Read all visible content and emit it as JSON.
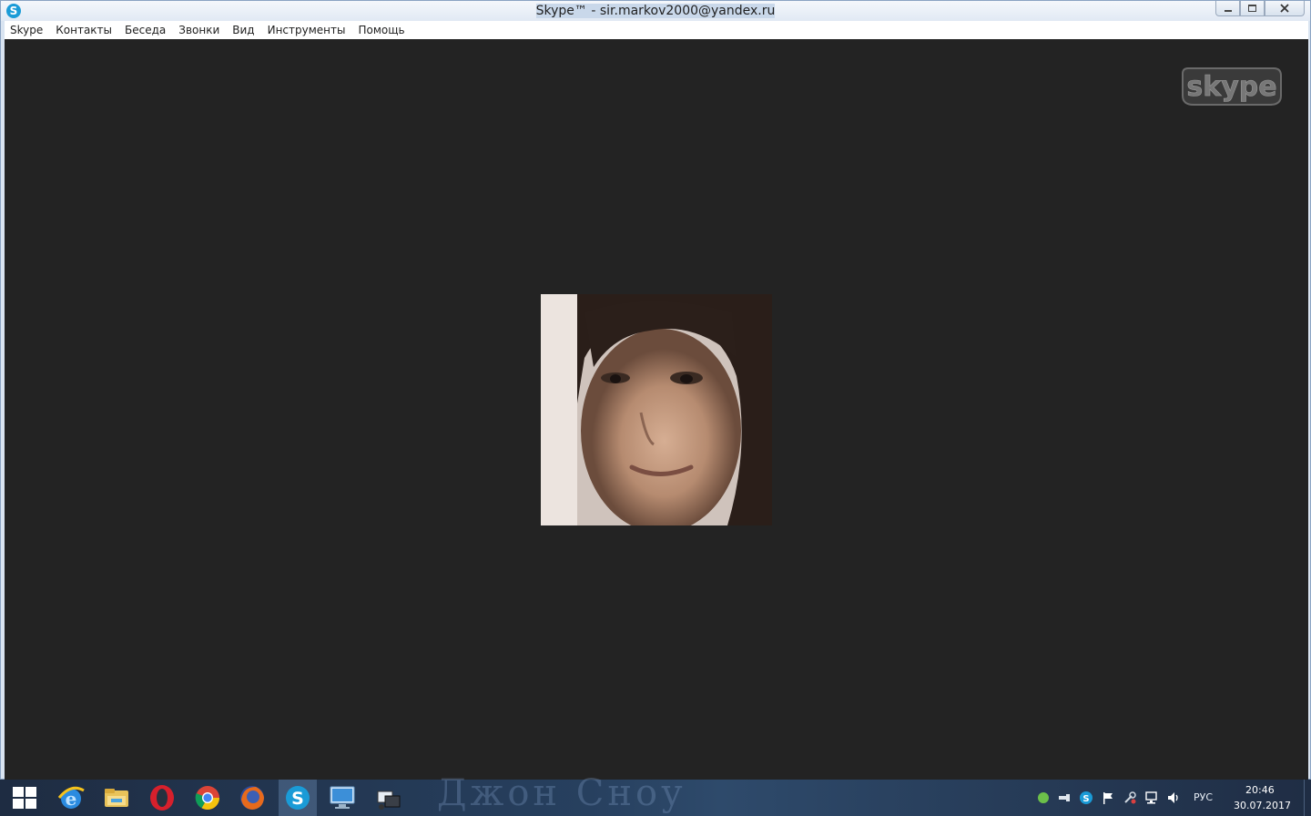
{
  "window": {
    "title": "Skype™ - sir.markov2000@yandex.ru",
    "app_icon_letter": "S"
  },
  "menu": {
    "items": [
      {
        "label": "Skype"
      },
      {
        "label": "Контакты"
      },
      {
        "label": "Беседа"
      },
      {
        "label": "Звонки"
      },
      {
        "label": "Вид"
      },
      {
        "label": "Инструменты"
      },
      {
        "label": "Помощь"
      }
    ]
  },
  "video": {
    "logo_text": "skype"
  },
  "taskbar": {
    "watermark": "Джон Сноу",
    "apps": [
      {
        "icon": "internet-explorer-icon"
      },
      {
        "icon": "file-explorer-icon"
      },
      {
        "icon": "opera-icon"
      },
      {
        "icon": "chrome-icon"
      },
      {
        "icon": "firefox-icon"
      },
      {
        "icon": "skype-icon"
      },
      {
        "icon": "remote-desktop-icon"
      },
      {
        "icon": "network-app-icon"
      }
    ],
    "tray": {
      "language": "РУС",
      "time": "20:46",
      "date": "30.07.2017"
    }
  },
  "colors": {
    "video_background": "#232323",
    "skype_blue": "#1a9bd7"
  }
}
